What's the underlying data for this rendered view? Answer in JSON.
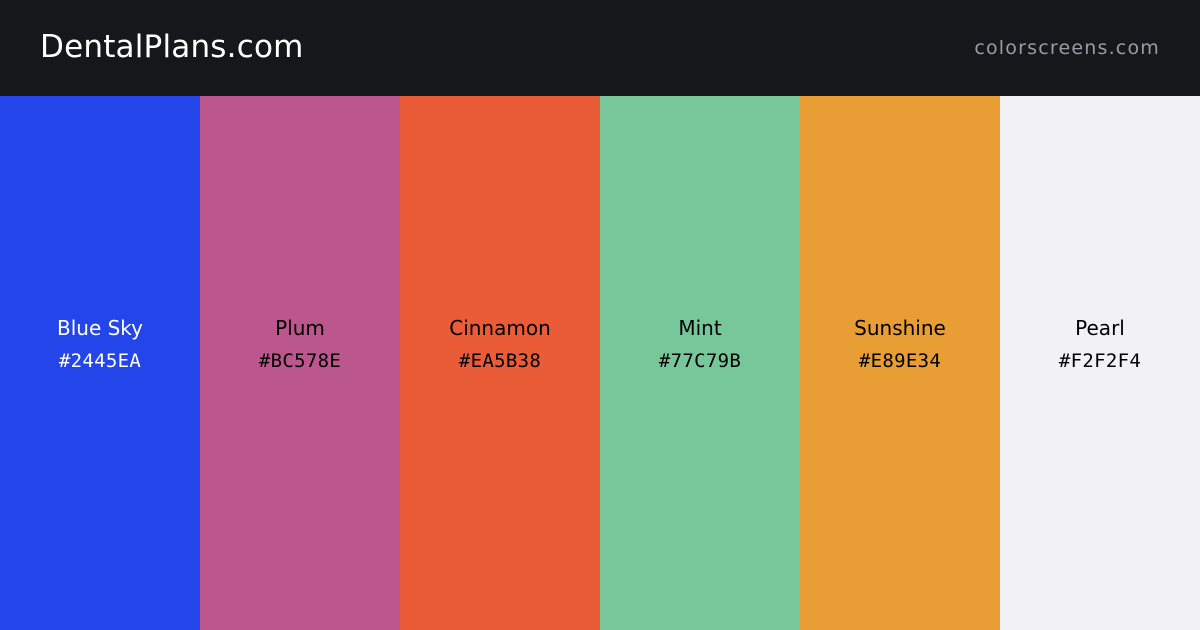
{
  "header": {
    "brand": "DentalPlans.com",
    "site": "colorscreens.com"
  },
  "palette": [
    {
      "name": "Blue Sky",
      "hex": "#2445EA",
      "color": "#2445EA",
      "text_color": "#FFFFFF"
    },
    {
      "name": "Plum",
      "hex": "#BC578E",
      "color": "#BC578E",
      "text_color": "#000000"
    },
    {
      "name": "Cinnamon",
      "hex": "#EA5B38",
      "color": "#EA5B38",
      "text_color": "#000000"
    },
    {
      "name": "Mint",
      "hex": "#77C79B",
      "color": "#77C79B",
      "text_color": "#000000"
    },
    {
      "name": "Sunshine",
      "hex": "#E89E34",
      "color": "#E89E34",
      "text_color": "#000000"
    },
    {
      "name": "Pearl",
      "hex": "#F2F2F4",
      "color": "#F2F2F4",
      "text_color": "#000000"
    }
  ]
}
